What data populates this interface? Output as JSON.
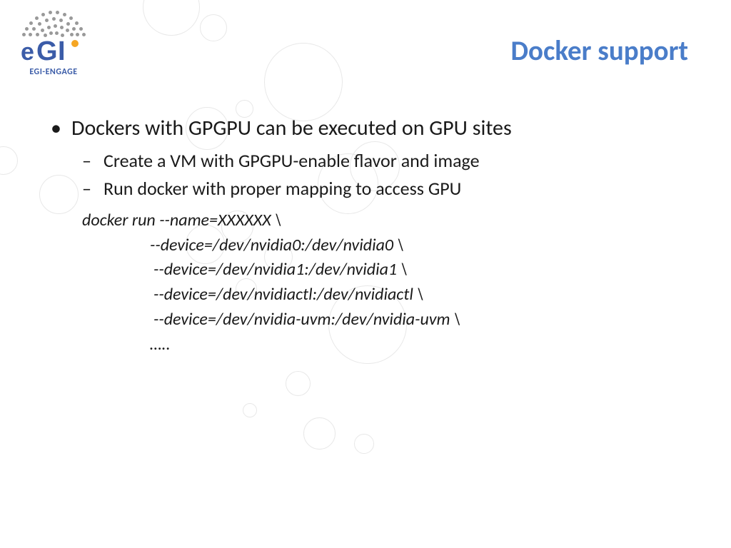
{
  "logo": {
    "name": "eGI",
    "sub": "EGI-ENGAGE"
  },
  "title": "Docker support",
  "bullets": {
    "l1": "Dockers with GPGPU can be executed on GPU sites",
    "l2a": "Create a VM with GPGPU-enable flavor and image",
    "l2b": "Run docker with proper mapping to access GPU"
  },
  "code": {
    "line1": "docker run --name=XXXXXX \\",
    "line2": "--device=/dev/nvidia0:/dev/nvidia0 \\",
    "line3": "--device=/dev/nvidia1:/dev/nvidia1 \\",
    "line4": "--device=/dev/nvidiactl:/dev/nvidiactl \\",
    "line5": "--device=/dev/nvidia-uvm:/dev/nvidia-uvm \\",
    "line6": "….."
  }
}
